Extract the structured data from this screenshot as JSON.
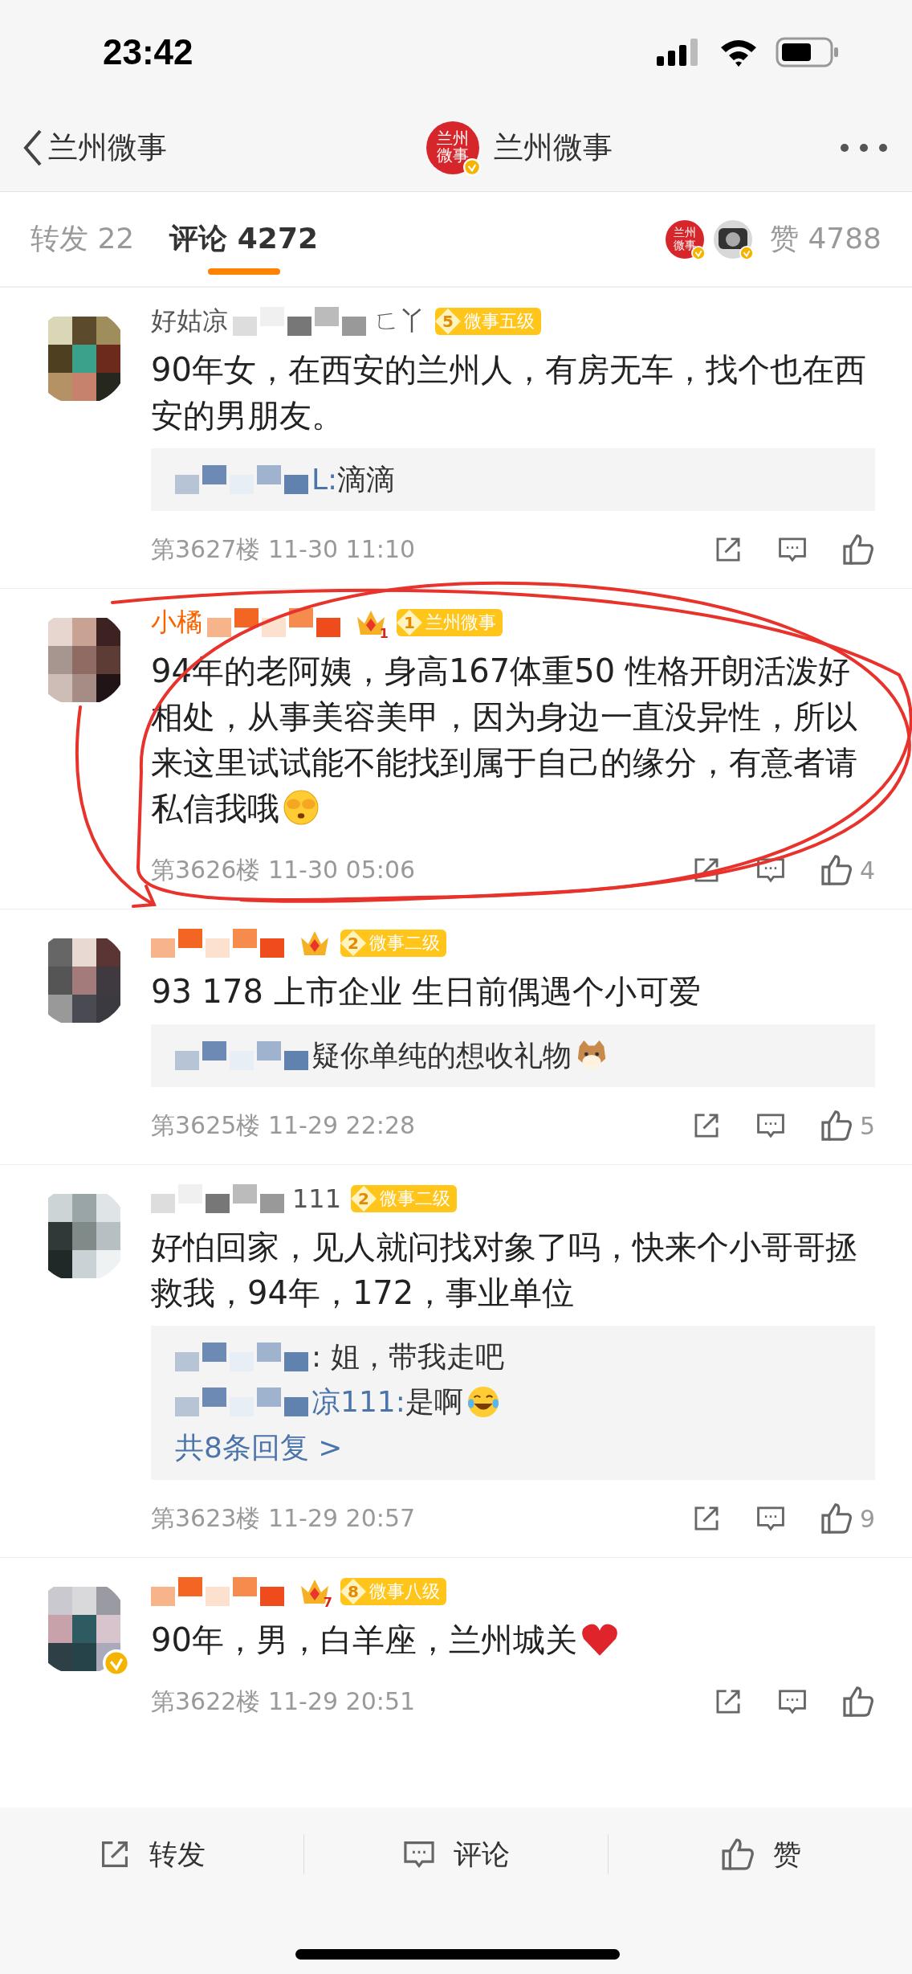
{
  "status_bar": {
    "time": "23:42"
  },
  "nav": {
    "back_label": "兰州微事",
    "title": "兰州微事",
    "logo_text": "兰州微事",
    "verified": true
  },
  "tabs": [
    {
      "label": "转发",
      "count": "22",
      "selected": false
    },
    {
      "label": "评论",
      "count": "4272",
      "selected": true
    }
  ],
  "like_summary": {
    "avatars": [
      {
        "kind": "logo",
        "text": "兰州微事",
        "verified": true
      },
      {
        "kind": "photo",
        "verified": true
      }
    ],
    "label": "赞",
    "count": "4788"
  },
  "comments": [
    {
      "verified": false,
      "vip": false,
      "name_parts": [
        {
          "kind": "text",
          "text": "好姑凉"
        },
        {
          "kind": "mosaic"
        },
        {
          "kind": "text",
          "text": "ㄈ丫"
        }
      ],
      "badge": {
        "level": "5",
        "text": "微事五级"
      },
      "text": "90年女，在西安的兰州人，有房无车，找个也在西安的男朋友。",
      "replies": [
        {
          "parts": [
            {
              "kind": "mosaic"
            },
            {
              "kind": "name",
              "text": "L:"
            },
            {
              "kind": "text",
              "text": " 滴滴"
            }
          ]
        }
      ],
      "floor": "第3627楼",
      "time": "11-30 11:10"
    },
    {
      "verified": false,
      "vip": true,
      "name_parts": [
        {
          "kind": "text",
          "text": "小橘"
        },
        {
          "kind": "mosaic"
        }
      ],
      "crown": {
        "kind": "crown",
        "level": "1"
      },
      "badge": {
        "level": "1",
        "text": "兰州微事"
      },
      "text": "94年的老阿姨，身高167体重50 性格开朗活泼好相处，从事美容美甲，因为身边一直没异性，所以来这里试试能不能找到属于自己的缘分，有意者请私信我哦",
      "emoji": {
        "kind": "cover-face"
      },
      "floor": "第3626楼",
      "time": "11-30 05:06",
      "likes": "4"
    },
    {
      "verified": false,
      "vip": true,
      "name_parts": [
        {
          "kind": "mosaic"
        }
      ],
      "crown": {
        "kind": "crown"
      },
      "badge": {
        "level": "2",
        "text": "微事二级"
      },
      "text": "93 178 上市企业 生日前偶遇个小可爱",
      "replies": [
        {
          "parts": [
            {
              "kind": "mosaic"
            },
            {
              "kind": "text",
              "text": "疑你单纯的想收礼物"
            },
            {
              "kind": "cat"
            }
          ]
        }
      ],
      "floor": "第3625楼",
      "time": "11-29 22:28",
      "likes": "5"
    },
    {
      "verified": false,
      "vip": false,
      "name_parts": [
        {
          "kind": "mosaic"
        },
        {
          "kind": "text",
          "text": "111"
        }
      ],
      "badge": {
        "level": "2",
        "text": "微事二级"
      },
      "text": "好怕回家，见人就问找对象了吗，快来个小哥哥拯救我，94年，172，事业单位",
      "replies": [
        {
          "parts": [
            {
              "kind": "mosaic"
            },
            {
              "kind": "text",
              "text": ": 姐，带我走吧"
            }
          ]
        },
        {
          "parts": [
            {
              "kind": "mosaic"
            },
            {
              "kind": "name",
              "text": "凉111:"
            },
            {
              "kind": "text",
              "text": "是啊"
            },
            {
              "kind": "laugh-cry"
            }
          ]
        }
      ],
      "more": "共8条回复 >",
      "floor": "第3623楼",
      "time": "11-29 20:57",
      "likes": "9"
    },
    {
      "verified": true,
      "vip": true,
      "name_parts": [
        {
          "kind": "mosaic"
        }
      ],
      "crown": {
        "kind": "crown",
        "level": "7"
      },
      "badge": {
        "level": "8",
        "text": "微事八级"
      },
      "text": "90年，男，白羊座，兰州城关",
      "emoji": {
        "kind": "heart"
      },
      "floor": "第3622楼",
      "time": "11-29 20:51"
    }
  ],
  "bottom_bar": [
    {
      "kind": "repost",
      "label": "转发"
    },
    {
      "kind": "comment",
      "label": "评论"
    },
    {
      "kind": "like",
      "label": "赞"
    }
  ]
}
